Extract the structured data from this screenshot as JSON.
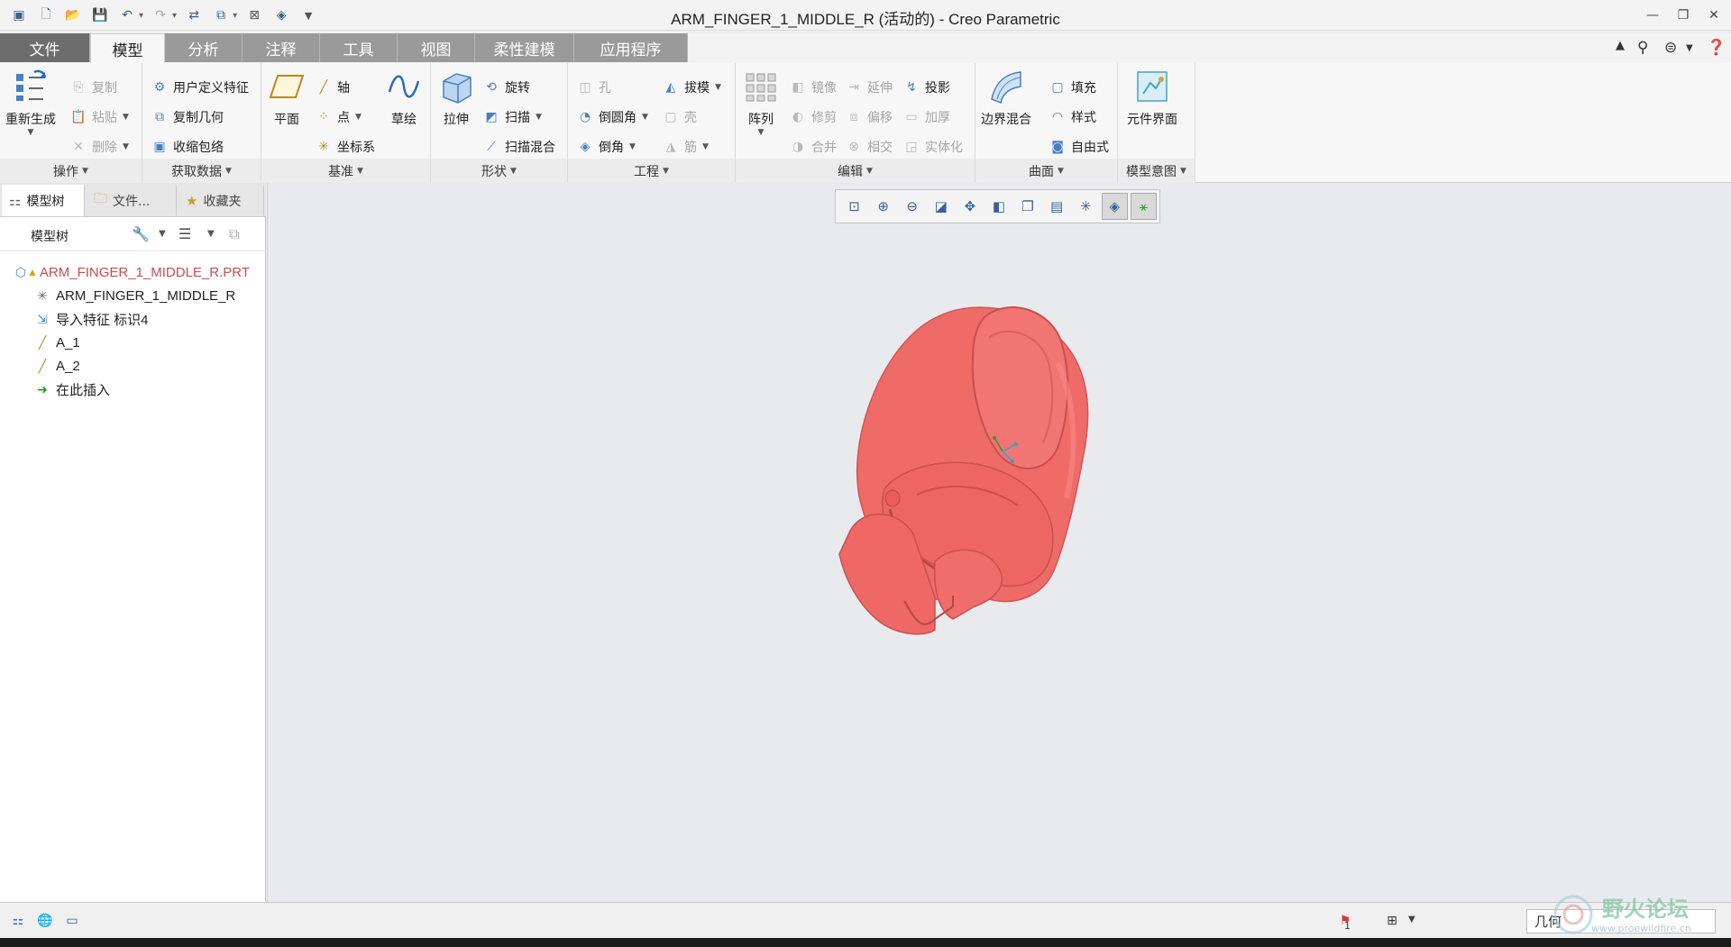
{
  "window": {
    "title": "ARM_FINGER_1_MIDDLE_R (活动的) - Creo Parametric"
  },
  "quick_access": [
    "app-icon",
    "new-icon",
    "open-icon",
    "save-icon",
    "undo-icon",
    "redo-icon",
    "regenerate-icon",
    "windows-icon",
    "close-window-icon",
    "display-icon",
    "customize-icon"
  ],
  "ribbon_tabs": [
    {
      "label": "文件"
    },
    {
      "label": "模型"
    },
    {
      "label": "分析"
    },
    {
      "label": "注释"
    },
    {
      "label": "工具"
    },
    {
      "label": "视图"
    },
    {
      "label": "柔性建模"
    },
    {
      "label": "应用程序"
    }
  ],
  "ribbon": {
    "operations": {
      "label": "操作",
      "regenerate": "重新生成",
      "copy": "复制",
      "paste": "粘贴",
      "delete": "删除"
    },
    "get_data": {
      "label": "获取数据",
      "udf": "用户定义特征",
      "copy_geom": "复制几何",
      "shrinkwrap": "收缩包络"
    },
    "datum": {
      "label": "基准",
      "plane": "平面",
      "axis": "轴",
      "point": "点",
      "csys": "坐标系",
      "sketch": "草绘"
    },
    "shapes": {
      "label": "形状",
      "extrude": "拉伸",
      "revolve": "旋转",
      "sweep": "扫描",
      "swept_blend": "扫描混合"
    },
    "engineering": {
      "label": "工程",
      "hole": "孔",
      "draft": "拔模",
      "round": "倒圆角",
      "shell": "壳",
      "chamfer": "倒角",
      "rib": "筋"
    },
    "editing": {
      "label": "编辑",
      "pattern": "阵列",
      "mirror": "镜像",
      "extend": "延伸",
      "project": "投影",
      "trim": "修剪",
      "offset": "偏移",
      "thicken": "加厚",
      "merge": "合并",
      "intersect": "相交",
      "solidify": "实体化"
    },
    "surfaces": {
      "label": "曲面",
      "boundary_blend": "边界混合",
      "fill": "填充",
      "style": "样式",
      "freestyle": "自由式"
    },
    "model_intent": {
      "label": "模型意图",
      "component_interface": "元件界面"
    }
  },
  "navigator": {
    "tabs": [
      {
        "label": "模型树"
      },
      {
        "label": "文件..."
      },
      {
        "label": "收藏夹"
      }
    ],
    "tree_label": "模型树",
    "tree": [
      {
        "label": "ARM_FINGER_1_MIDDLE_R.PRT"
      },
      {
        "label": "ARM_FINGER_1_MIDDLE_R"
      },
      {
        "label": "导入特征 标识4"
      },
      {
        "label": "A_1"
      },
      {
        "label": "A_2"
      },
      {
        "label": "在此插入"
      }
    ]
  },
  "view_toolbar": [
    "refit-icon",
    "zoom-in-icon",
    "zoom-out-icon",
    "repaint-icon",
    "spin-center-icon",
    "display-style-icon",
    "saved-views-icon",
    "view-manager-icon",
    "datum-display-icon",
    "annotation-display-icon",
    "csys-display-icon"
  ],
  "status": {
    "message_count": "1",
    "filter_value": "几何"
  },
  "watermark": {
    "text": "野火论坛",
    "url": "www.proewildfire.cn"
  },
  "colors": {
    "model": "#ef6b68",
    "model_shadow": "#c94f4f",
    "root_text": "#d14b4b"
  }
}
